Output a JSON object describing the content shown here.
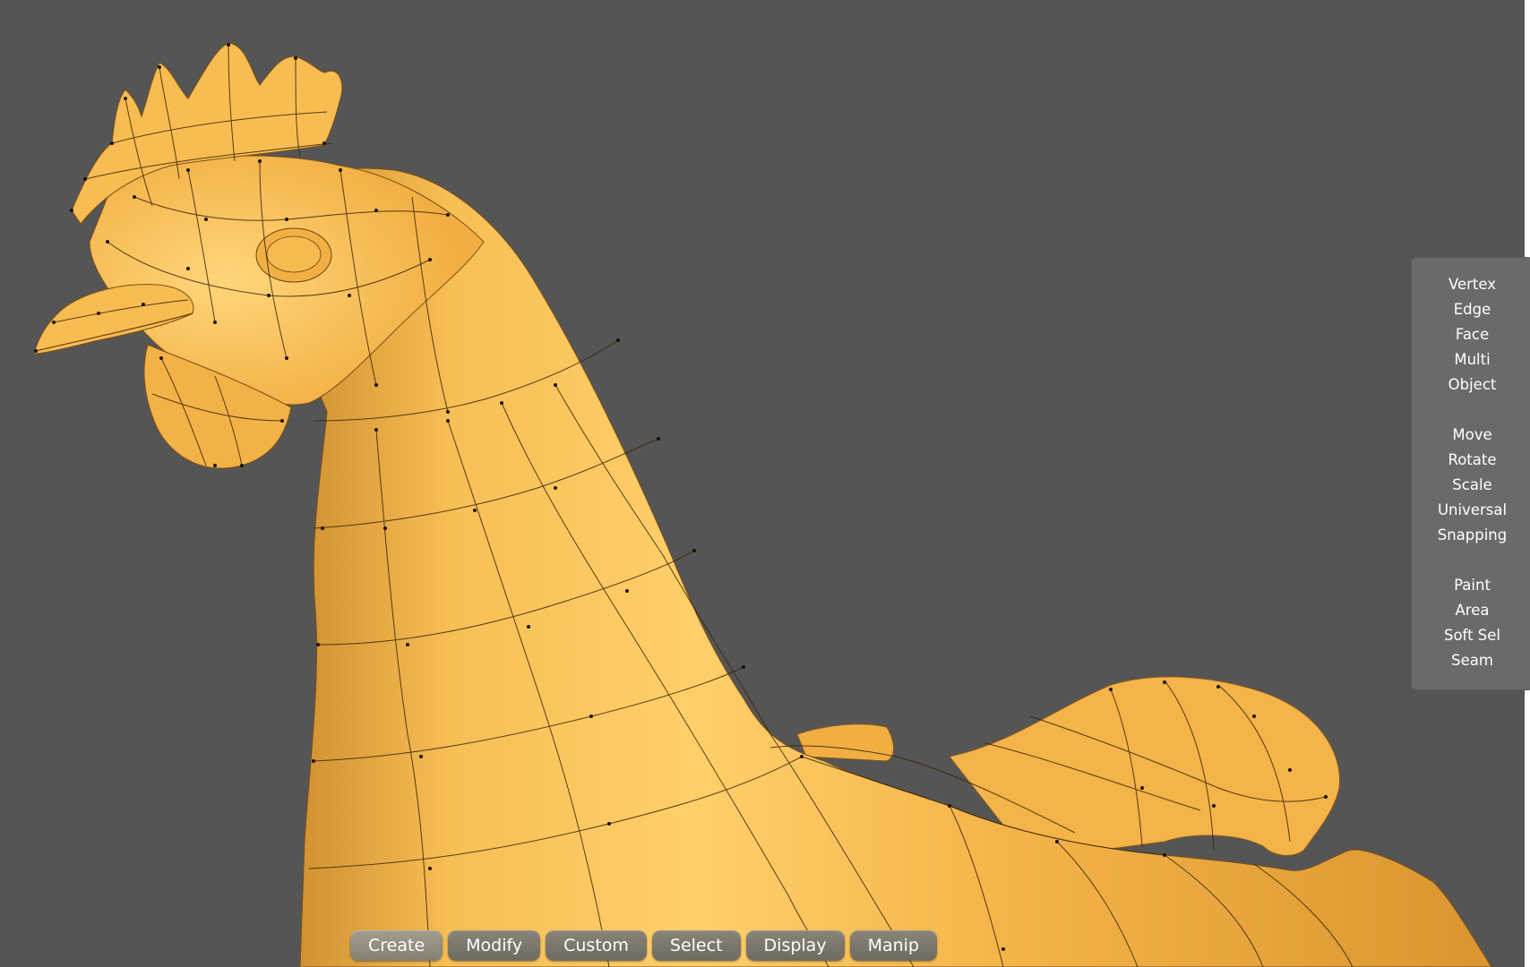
{
  "side_menu": {
    "groups": [
      [
        "Vertex",
        "Edge",
        "Face",
        "Multi",
        "Object"
      ],
      [
        "Move",
        "Rotate",
        "Scale",
        "Universal",
        "Snapping"
      ],
      [
        "Paint",
        "Area",
        "Soft Sel",
        "Seam"
      ]
    ]
  },
  "bottom_tabs": [
    "Create",
    "Modify",
    "Custom",
    "Select",
    "Display",
    "Manip"
  ],
  "active_tab": "Create",
  "colors": {
    "viewport_bg": "#555555",
    "model_fill": "#f6b84e",
    "wire": "#2a1a08"
  }
}
